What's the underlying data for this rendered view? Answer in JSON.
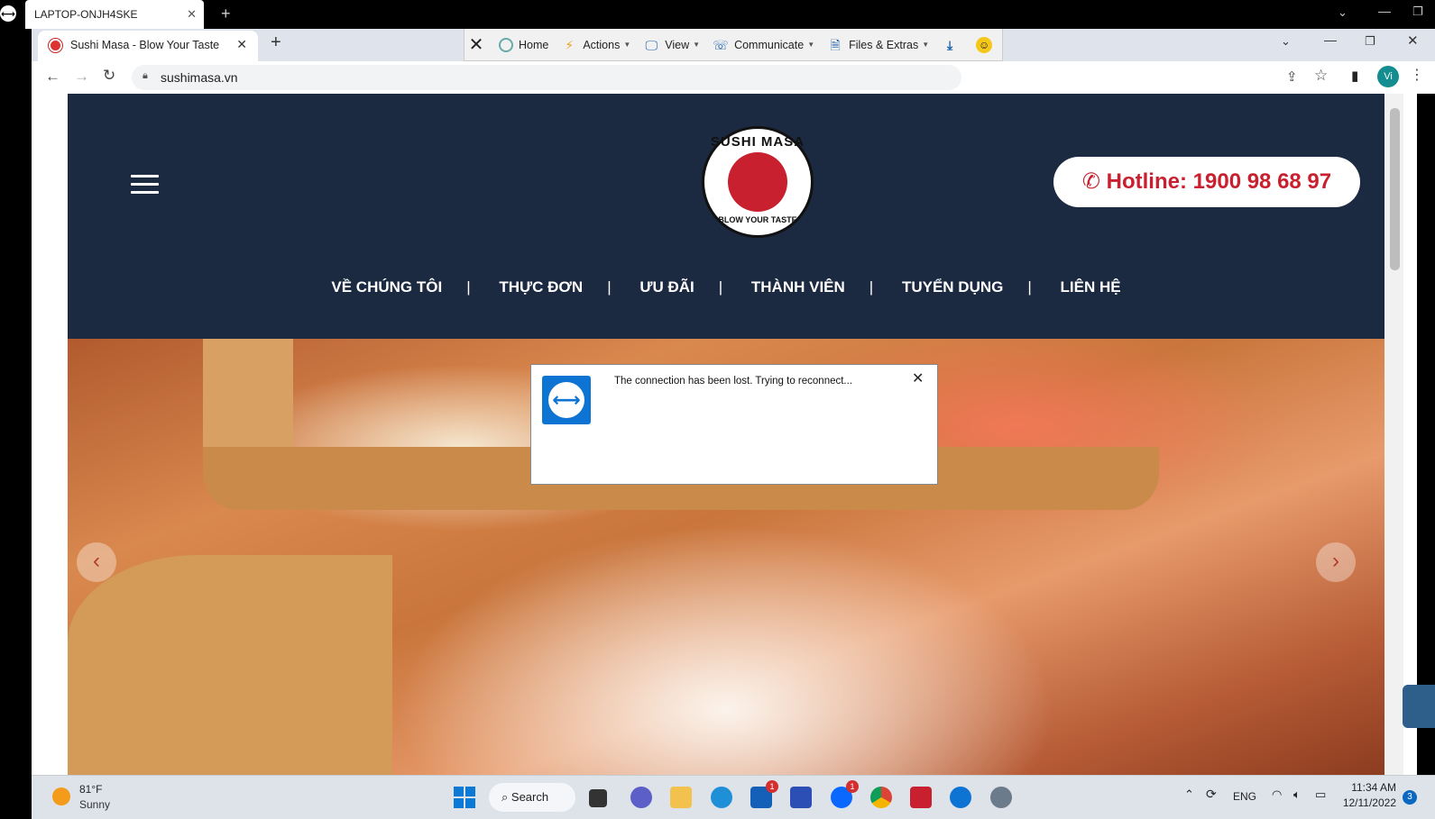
{
  "teamviewer": {
    "tab_title": "LAPTOP-ONJH4SKE",
    "toolbar": {
      "home": "Home",
      "actions": "Actions",
      "view": "View",
      "communicate": "Communicate",
      "files_extras": "Files & Extras"
    },
    "dialog": {
      "message": "The connection has been lost. Trying to reconnect..."
    }
  },
  "browser": {
    "tab_title": "Sushi Masa - Blow Your Taste",
    "url": "sushimasa.vn",
    "profile_initial": "Vi"
  },
  "site": {
    "logo_top": "SUSHI MASA",
    "logo_bottom": "BLOW YOUR TASTE",
    "hotline": "Hotline: 1900 98 68 97",
    "nav": [
      "VỀ CHÚNG TÔI",
      "THỰC ĐƠN",
      "ƯU ĐÃI",
      "THÀNH VIÊN",
      "TUYỂN DỤNG",
      "LIÊN HỆ"
    ]
  },
  "taskbar": {
    "weather_temp": "81°F",
    "weather_desc": "Sunny",
    "search_label": "Search",
    "zalo_badge": "1",
    "store_badge": "1",
    "lang": "ENG",
    "time": "11:34 AM",
    "date": "12/11/2022",
    "notifications": "3"
  }
}
